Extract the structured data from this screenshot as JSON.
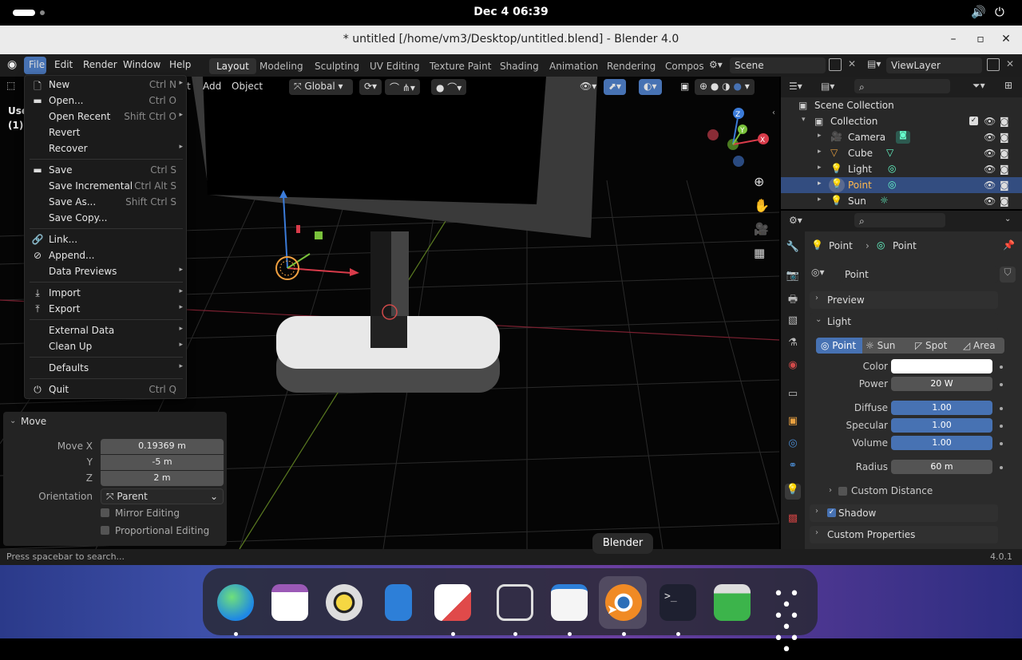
{
  "system": {
    "clock": "Dec 4  06:39"
  },
  "window": {
    "title": "* untitled [/home/vm3/Desktop/untitled.blend] - Blender 4.0"
  },
  "menubar": {
    "file": "File",
    "edit": "Edit",
    "render": "Render",
    "window": "Window",
    "help": "Help"
  },
  "workspaces": [
    "Layout",
    "Modeling",
    "Sculpting",
    "UV Editing",
    "Texture Paint",
    "Shading",
    "Animation",
    "Rendering",
    "Compos"
  ],
  "scene": {
    "name": "Scene",
    "view_layer": "ViewLayer"
  },
  "viewport_header": {
    "add": "Add",
    "object": "Object",
    "orientation": "Global",
    "partial_label": "t",
    "overlay_text_1": "Use",
    "overlay_text_2": "(1)"
  },
  "file_menu": {
    "new": {
      "label": "New",
      "shortcut": "Ctrl N"
    },
    "open": {
      "label": "Open...",
      "shortcut": "Ctrl O"
    },
    "open_recent": {
      "label": "Open Recent",
      "shortcut": "Shift Ctrl O"
    },
    "revert": {
      "label": "Revert"
    },
    "recover": {
      "label": "Recover"
    },
    "save": {
      "label": "Save",
      "shortcut": "Ctrl S"
    },
    "save_incremental": {
      "label": "Save Incremental",
      "shortcut": "Ctrl Alt S"
    },
    "save_as": {
      "label": "Save As...",
      "shortcut": "Shift Ctrl S"
    },
    "save_copy": {
      "label": "Save Copy..."
    },
    "link": {
      "label": "Link..."
    },
    "append": {
      "label": "Append..."
    },
    "data_previews": {
      "label": "Data Previews"
    },
    "import": {
      "label": "Import"
    },
    "export": {
      "label": "Export"
    },
    "external_data": {
      "label": "External Data"
    },
    "clean_up": {
      "label": "Clean Up"
    },
    "defaults": {
      "label": "Defaults"
    },
    "quit": {
      "label": "Quit",
      "shortcut": "Ctrl Q"
    }
  },
  "move_panel": {
    "title": "Move",
    "move_x_label": "Move X",
    "move_x": "0.19369 m",
    "y_label": "Y",
    "y": "-5 m",
    "z_label": "Z",
    "z": "2 m",
    "orientation_label": "Orientation",
    "orientation": "Parent",
    "mirror_editing": "Mirror Editing",
    "proportional_editing": "Proportional Editing"
  },
  "outliner": {
    "root": "Scene Collection",
    "collection": "Collection",
    "items": [
      {
        "name": "Camera"
      },
      {
        "name": "Cube"
      },
      {
        "name": "Light"
      },
      {
        "name": "Point",
        "selected": true
      },
      {
        "name": "Sun"
      }
    ]
  },
  "properties": {
    "breadcrumb_object": "Point",
    "breadcrumb_data": "Point",
    "datablock": "Point",
    "preview": "Preview",
    "light_section": "Light",
    "light_types": [
      "Point",
      "Sun",
      "Spot",
      "Area"
    ],
    "active_light_type": "Point",
    "color_label": "Color",
    "color_value": "#ffffff",
    "power_label": "Power",
    "power": "20 W",
    "diffuse_label": "Diffuse",
    "diffuse": "1.00",
    "specular_label": "Specular",
    "specular": "1.00",
    "volume_label": "Volume",
    "volume": "1.00",
    "radius_label": "Radius",
    "radius": "60 m",
    "custom_distance": "Custom Distance",
    "shadow": "Shadow",
    "custom_properties": "Custom Properties"
  },
  "status": {
    "hint": "Press spacebar to search...",
    "version": "4.0.1"
  },
  "dock": {
    "tooltip": "Blender"
  }
}
